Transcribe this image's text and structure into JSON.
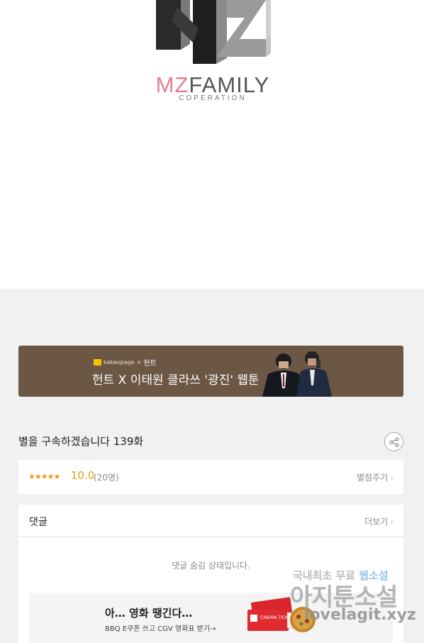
{
  "logo": {
    "main_prefix": "MZ",
    "main_suffix": "FAMILY",
    "sub": "COPERATION"
  },
  "banner": {
    "brand_small": "kakaopage",
    "brand_x": "×",
    "brand_hunt": "헌트",
    "title": "헌트 X 이태원 클라쓰 '광진' 웹툰"
  },
  "episode": {
    "title": "별을 구속하겠습니다 139화"
  },
  "rating": {
    "stars": "★★★★★",
    "score": "10.0",
    "count": "(20명)",
    "rate_label": "별점주기"
  },
  "comments": {
    "label": "댓글",
    "more_label": "더보기",
    "hidden_message": "댓글 숨김 상태입니다."
  },
  "ad": {
    "title": "아… 영화 땡긴다…",
    "subtitle": "BBQ E쿠폰 쓰고 CGV 영화표 받기→",
    "ticket_text": "CINEMA TICKET"
  },
  "watermark": {
    "line1_a": "국내최초 무료",
    "line1_b": "웹소설",
    "line2": "아지툰소설",
    "line3": "lovelagit.xyz"
  },
  "icons": {
    "share": "share-icon",
    "chevron": "chevron-right-icon"
  },
  "colors": {
    "banner_bg": "#6c5644",
    "accent_star": "#e89b1a",
    "page_gray": "#f1f1f1"
  }
}
